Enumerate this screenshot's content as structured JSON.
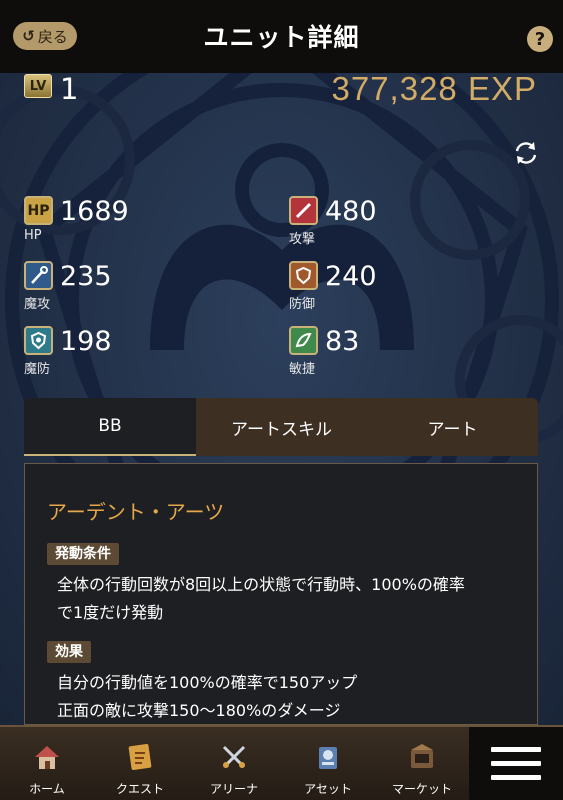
{
  "header": {
    "back_label": "戻る",
    "title": "ユニット詳細",
    "help_icon": "?"
  },
  "unit": {
    "lv_badge": "LV",
    "level": "1",
    "exp": "377,328 EXP"
  },
  "stats": [
    {
      "icon": "HP",
      "label": "HP",
      "value": "1689",
      "color": "#c9a243"
    },
    {
      "icon": "atk",
      "label": "攻撃",
      "value": "480",
      "color": "#b3343a"
    },
    {
      "icon": "matk",
      "label": "魔攻",
      "value": "235",
      "color": "#2f5a8a"
    },
    {
      "icon": "def",
      "label": "防御",
      "value": "240",
      "color": "#a0592c"
    },
    {
      "icon": "mdef",
      "label": "魔防",
      "value": "198",
      "color": "#2f7a8a"
    },
    {
      "icon": "agi",
      "label": "敏捷",
      "value": "83",
      "color": "#3f8a4a"
    }
  ],
  "tabs": [
    {
      "label": "BB",
      "active": true
    },
    {
      "label": "アートスキル",
      "active": false
    },
    {
      "label": "アート",
      "active": false
    }
  ],
  "skill": {
    "name": "アーデント・アーツ",
    "condition_tag": "発動条件",
    "condition_lines": [
      "全体の行動回数が8回以上の状態で行動時、100%の確率",
      "で1度だけ発動"
    ],
    "effect_tag": "効果",
    "effect_lines": [
      "自分の行動値を100%の確率で150アップ",
      "正面の敵に攻撃150〜180%のダメージ"
    ]
  },
  "nav": [
    {
      "label": "ホーム",
      "icon": "home-icon"
    },
    {
      "label": "クエスト",
      "icon": "quest-icon"
    },
    {
      "label": "アリーナ",
      "icon": "arena-icon"
    },
    {
      "label": "アセット",
      "icon": "asset-icon"
    },
    {
      "label": "マーケット",
      "icon": "market-icon"
    }
  ],
  "colors": {
    "accent_gold": "#d2ac66",
    "skill_orange": "#e6a84a",
    "background": "#24324a"
  }
}
